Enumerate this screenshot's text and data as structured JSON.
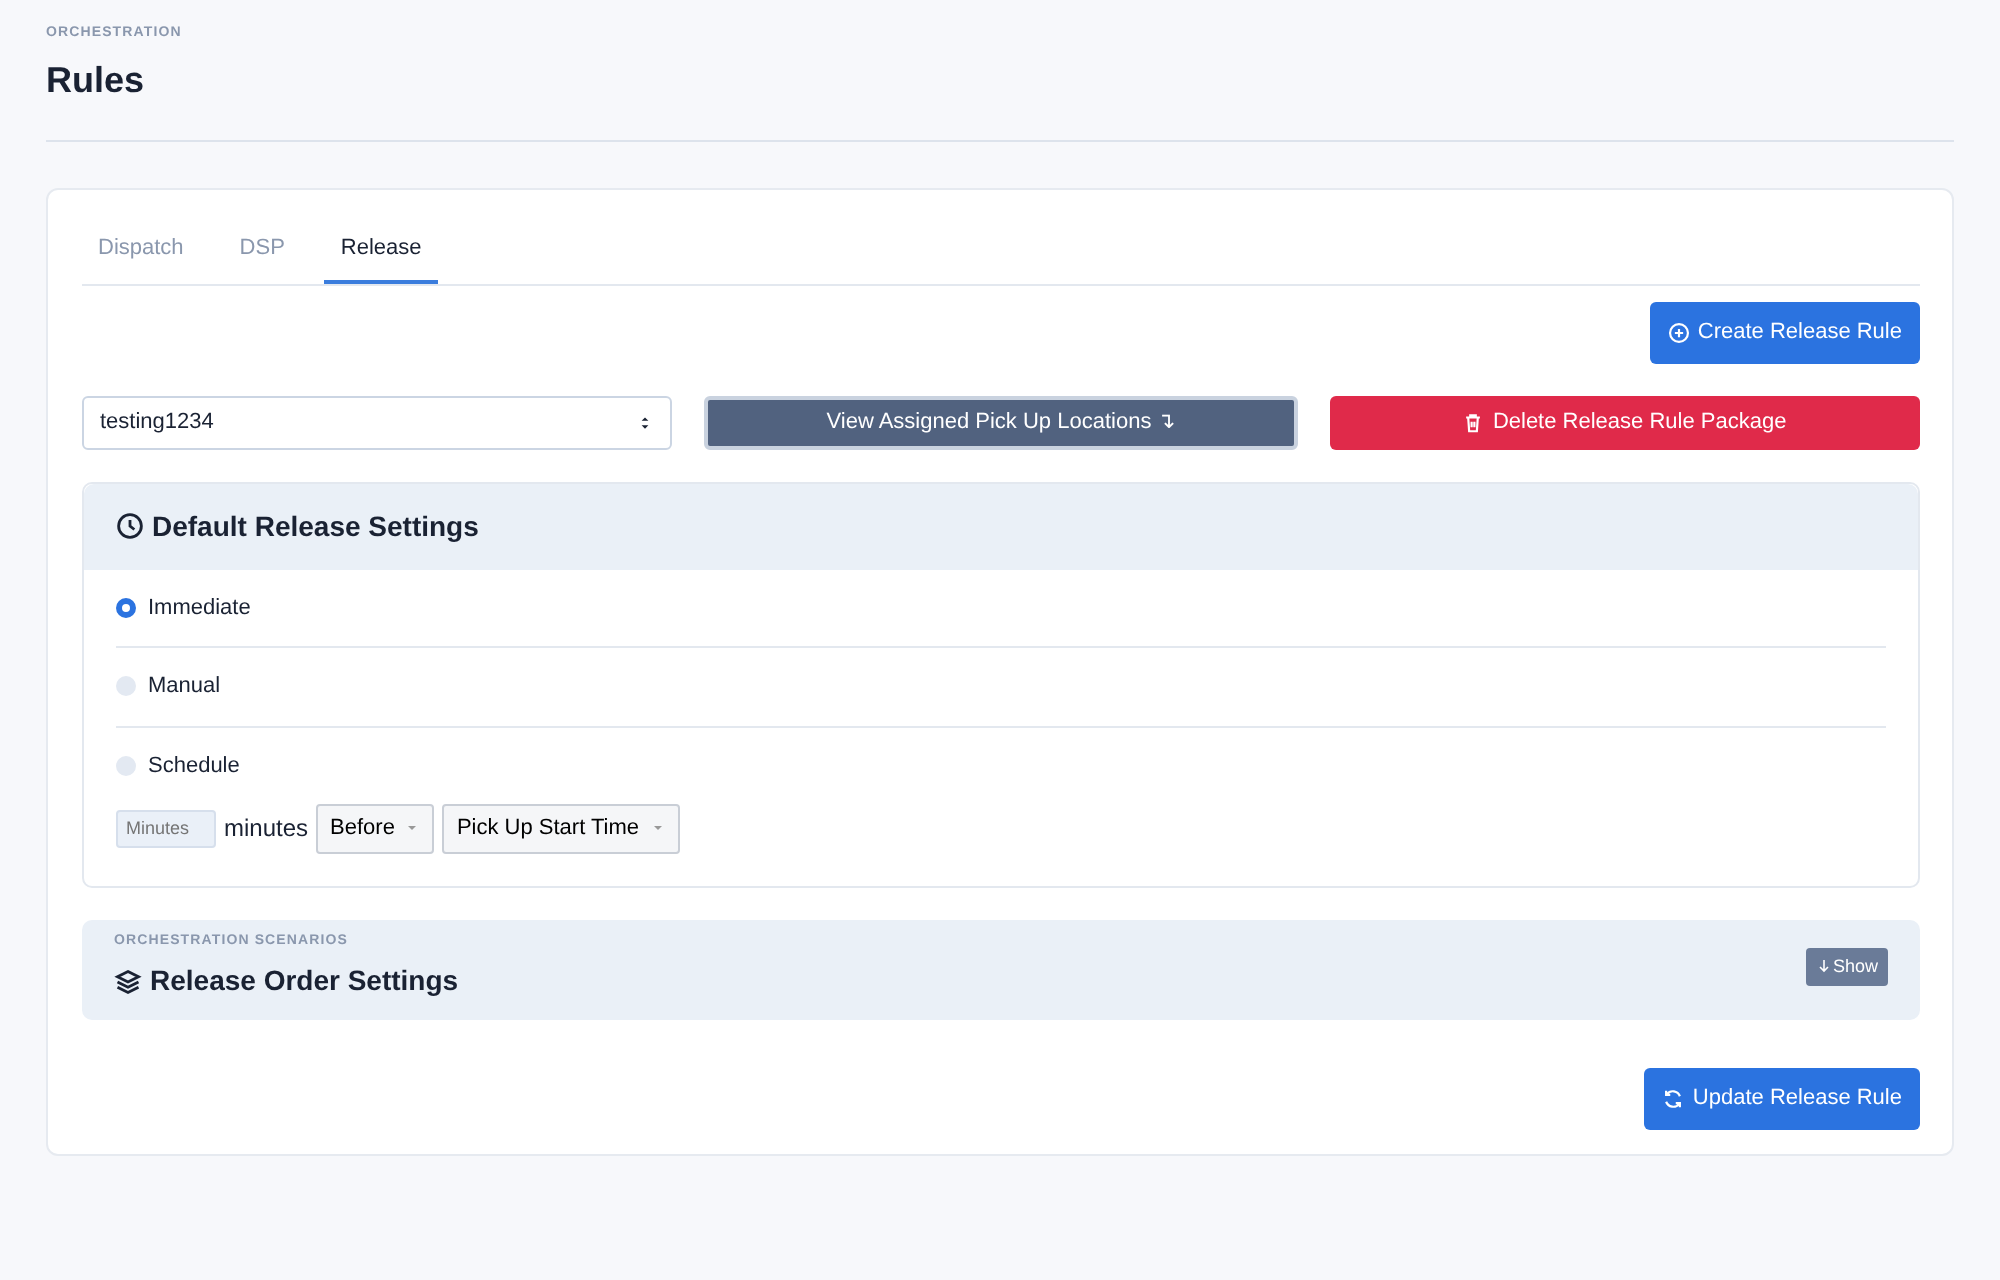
{
  "header": {
    "eyebrow": "ORCHESTRATION",
    "title": "Rules"
  },
  "tabs": [
    {
      "label": "Dispatch",
      "selected": false
    },
    {
      "label": "DSP",
      "selected": false
    },
    {
      "label": "Release",
      "selected": true
    }
  ],
  "create_button": "Create Release Rule",
  "package_select": {
    "value": "testing1234"
  },
  "view_button": {
    "label": "View Assigned Pick Up Locations",
    "glyph": "↴"
  },
  "delete_button": "Delete Release Rule Package",
  "default_settings": {
    "title": "Default Release Settings",
    "options": [
      {
        "label": "Immediate",
        "selected": true
      },
      {
        "label": "Manual",
        "selected": false
      },
      {
        "label": "Schedule",
        "selected": false
      }
    ],
    "schedule": {
      "minutes_placeholder": "Minutes",
      "unit": "minutes",
      "relation": "Before",
      "reference": "Pick Up Start Time"
    }
  },
  "order_settings": {
    "eyebrow": "ORCHESTRATION SCENARIOS",
    "title": "Release Order Settings",
    "toggle": "Show"
  },
  "update_button": "Update Release Rule"
}
